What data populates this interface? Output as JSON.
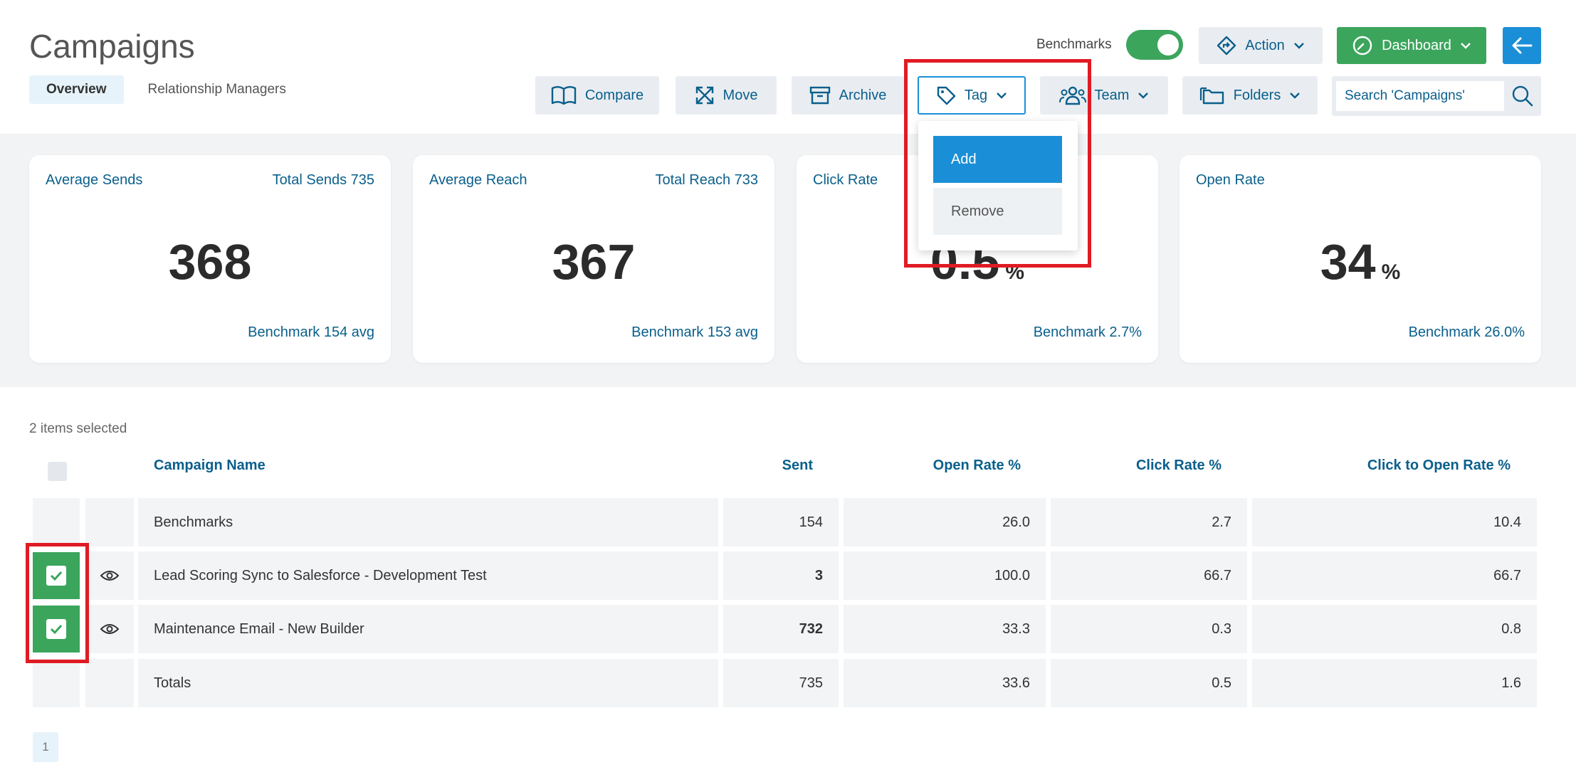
{
  "header": {
    "title": "Campaigns",
    "subtabs": [
      "Overview",
      "Relationship Managers"
    ],
    "benchmarks_label": "Benchmarks",
    "benchmarks_on": true,
    "action_label": "Action",
    "dashboard_label": "Dashboard"
  },
  "toolbar": {
    "compare": "Compare",
    "move": "Move",
    "archive": "Archive",
    "tag": "Tag",
    "team": "Team",
    "folders": "Folders",
    "search_placeholder": "Search 'Campaigns'"
  },
  "tag_menu": {
    "add": "Add",
    "remove": "Remove"
  },
  "cards": [
    {
      "top_left": "Average Sends",
      "top_right": "Total Sends 735",
      "value": "368",
      "unit": "",
      "benchmark": "Benchmark 154 avg"
    },
    {
      "top_left": "Average Reach",
      "top_right": "Total Reach 733",
      "value": "367",
      "unit": "",
      "benchmark": "Benchmark 153 avg"
    },
    {
      "top_left": "Click Rate",
      "top_right": "",
      "value": "0.5",
      "unit": "%",
      "benchmark": "Benchmark 2.7%"
    },
    {
      "top_left": "Open Rate",
      "top_right": "",
      "value": "34",
      "unit": "%",
      "benchmark": "Benchmark 26.0%"
    }
  ],
  "table": {
    "selection_info": "2 items selected",
    "columns": [
      "Campaign Name",
      "Sent",
      "Open Rate %",
      "Click Rate %",
      "Click to Open Rate %"
    ],
    "rows": [
      {
        "name": "Benchmarks",
        "sent": "154",
        "open": "26.0",
        "click": "2.7",
        "cto": "10.4"
      },
      {
        "name": "Lead Scoring Sync to Salesforce - Development Test",
        "sent": "3",
        "open": "100.0",
        "click": "66.7",
        "cto": "66.7"
      },
      {
        "name": "Maintenance Email - New Builder",
        "sent": "732",
        "open": "33.3",
        "click": "0.3",
        "cto": "0.8"
      },
      {
        "name": "Totals",
        "sent": "735",
        "open": "33.6",
        "click": "0.5",
        "cto": "1.6"
      }
    ]
  },
  "pagination": {
    "current": "1"
  }
}
